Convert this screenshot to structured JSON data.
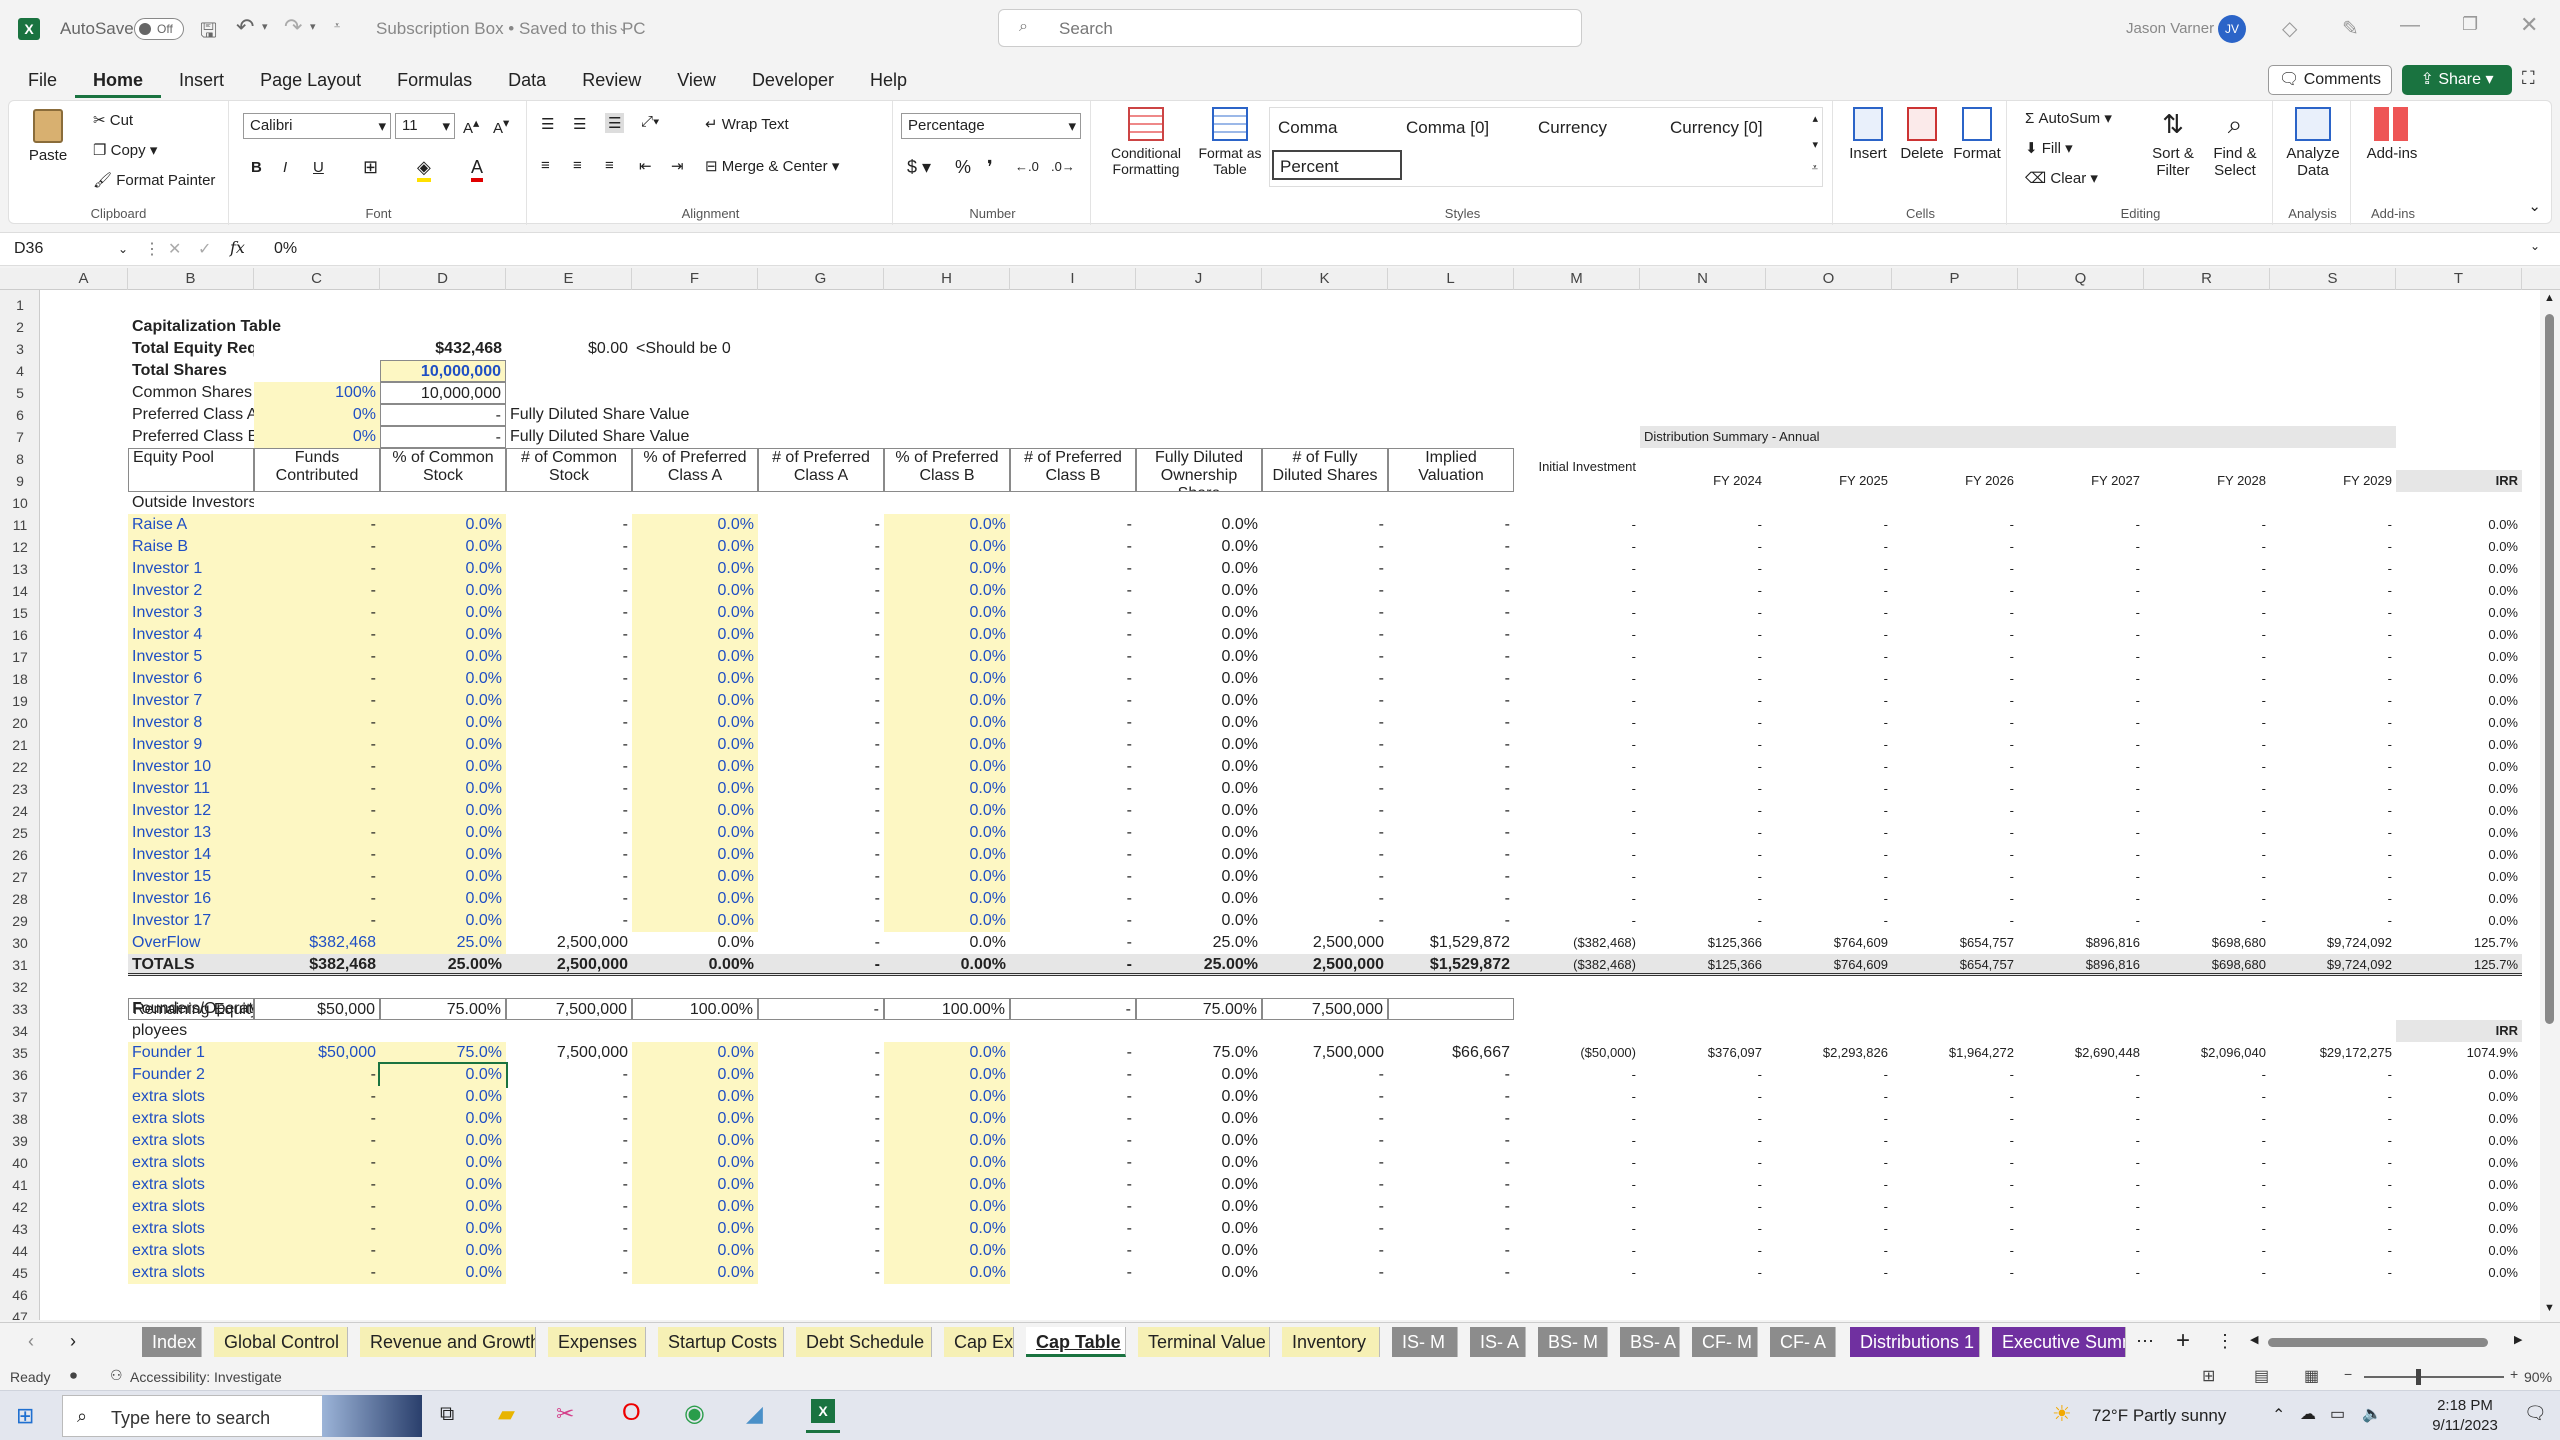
{
  "app": {
    "autosave": "AutoSave",
    "autosave_state": "Off",
    "doc_title": "Subscription Box • Saved to this PC",
    "search_placeholder": "Search",
    "user_name": "Jason Varner",
    "user_initials": "JV"
  },
  "menu": [
    "File",
    "Home",
    "Insert",
    "Page Layout",
    "Formulas",
    "Data",
    "Review",
    "View",
    "Developer",
    "Help"
  ],
  "menu_right": {
    "comments": "Comments",
    "share": "Share"
  },
  "ribbon": {
    "clipboard": {
      "paste": "Paste",
      "cut": "Cut",
      "copy": "Copy",
      "format_painter": "Format Painter",
      "label": "Clipboard"
    },
    "font": {
      "name": "Calibri",
      "size": "11",
      "label": "Font"
    },
    "alignment": {
      "wrap": "Wrap Text",
      "merge": "Merge & Center",
      "label": "Alignment"
    },
    "number": {
      "format": "Percentage",
      "label": "Number"
    },
    "styles": {
      "cond": "Conditional Formatting",
      "fmt_table": "Format as Table",
      "comma": "Comma",
      "comma0": "Comma [0]",
      "currency": "Currency",
      "currency0": "Currency [0]",
      "percent": "Percent",
      "label": "Styles"
    },
    "cells": {
      "insert": "Insert",
      "delete": "Delete",
      "format": "Format",
      "label": "Cells"
    },
    "editing": {
      "autosum": "AutoSum",
      "fill": "Fill",
      "clear": "Clear",
      "sort": "Sort & Filter",
      "find": "Find & Select",
      "label": "Editing"
    },
    "analysis": {
      "analyze": "Analyze Data",
      "label": "Analysis"
    },
    "addins": {
      "addins": "Add-ins",
      "label": "Add-ins"
    }
  },
  "formula": {
    "cell_ref": "D36",
    "fx": "fx",
    "value": "0%"
  },
  "columns": [
    "A",
    "B",
    "C",
    "D",
    "E",
    "F",
    "G",
    "H",
    "I",
    "J",
    "K",
    "L",
    "M",
    "N",
    "O",
    "P",
    "Q",
    "R",
    "S",
    "T"
  ],
  "top": {
    "title": "Capitalization Table",
    "r3": {
      "label": "Total Equity Required",
      "value": "$432,468",
      "check": "$0.00",
      "note": "<Should be 0"
    },
    "r4": {
      "label": "Total Shares",
      "value": "10,000,000"
    },
    "r5": {
      "label": "Common Shares",
      "pct": "100%",
      "value": "10,000,000"
    },
    "r6": {
      "label": "Preferred Class A",
      "pct": "0%",
      "value": "-",
      "note": "Fully Diluted Share Value"
    },
    "r7": {
      "label": "Preferred Class B",
      "pct": "0%",
      "value": "-",
      "note": "Fully Diluted Share Value"
    },
    "dist_title": "Distribution Summary - Annual"
  },
  "headers": {
    "b": "Equity Pool",
    "c": "Funds Contributed",
    "d": "% of Common Stock",
    "e": "# of Common Stock",
    "f": "% of Preferred Class A",
    "g": "# of Preferred Class A",
    "h": "% of Preferred Class B",
    "i": "# of Preferred Class B",
    "j": "Fully Diluted Ownership Share",
    "k": "# of Fully Diluted Shares",
    "l": "Implied Valuation",
    "m": "Initial Investment",
    "n": "FY 2024",
    "o": "FY 2025",
    "p": "FY 2026",
    "q": "FY 2027",
    "r": "FY 2028",
    "s": "FY 2029",
    "t": "IRR"
  },
  "outside_label": "Outside Investors",
  "investors": [
    "Raise A",
    "Raise B",
    "Investor 1",
    "Investor 2",
    "Investor 3",
    "Investor 4",
    "Investor 5",
    "Investor 6",
    "Investor 7",
    "Investor 8",
    "Investor 9",
    "Investor 10",
    "Investor 11",
    "Investor 12",
    "Investor 13",
    "Investor 14",
    "Investor 15",
    "Investor 16",
    "Investor 17"
  ],
  "blank": {
    "dash": "-",
    "pct": "0.0%"
  },
  "overflow": {
    "b": "OverFlow",
    "c": "$382,468",
    "d": "25.0%",
    "e": "2,500,000",
    "f": "0.0%",
    "g": "-",
    "h": "0.0%",
    "i": "-",
    "j": "25.0%",
    "k": "2,500,000",
    "l": "$1,529,872",
    "m": "($382,468)",
    "n": "$125,366",
    "o": "$764,609",
    "p": "$654,757",
    "q": "$896,816",
    "r": "$698,680",
    "s": "$9,724,092",
    "t": "125.7%"
  },
  "totals": {
    "b": "TOTALS",
    "c": "$382,468",
    "d": "25.00%",
    "e": "2,500,000",
    "f": "0.00%",
    "g": "-",
    "h": "0.00%",
    "i": "-",
    "j": "25.00%",
    "k": "2,500,000",
    "l": "$1,529,872",
    "m": "($382,468)",
    "n": "$125,366",
    "o": "$764,609",
    "p": "$654,757",
    "q": "$896,816",
    "r": "$698,680",
    "s": "$9,724,092",
    "t": "125.7%"
  },
  "remaining": {
    "b": "Remaining Equity",
    "c": "$50,000",
    "d": "75.00%",
    "e": "7,500,000",
    "f": "100.00%",
    "g": "-",
    "h": "100.00%",
    "i": "-",
    "j": "75.00%",
    "k": "7,500,000"
  },
  "founders_label": "Founders/Operators/Em ployees",
  "founders_label1": "Founders/Operators/Em",
  "founders_label2": "ployees",
  "irr2": "IRR",
  "founder1": {
    "b": "Founder 1",
    "c": "$50,000",
    "d": "75.0%",
    "e": "7,500,000",
    "f": "0.0%",
    "g": "-",
    "h": "0.0%",
    "i": "-",
    "j": "75.0%",
    "k": "7,500,000",
    "l": "$66,667",
    "m": "($50,000)",
    "n": "$376,097",
    "o": "$2,293,826",
    "p": "$1,964,272",
    "q": "$2,690,448",
    "r": "$2,096,040",
    "s": "$29,172,275",
    "t": "1074.9%"
  },
  "founder_rows": [
    "Founder 2",
    "extra slots",
    "extra slots",
    "extra slots",
    "extra slots",
    "extra slots",
    "extra slots",
    "extra slots",
    "extra slots",
    "extra slots"
  ],
  "tabs": [
    "Index",
    "Global Control",
    "Revenue and Growth",
    "Expenses",
    "Startup Costs",
    "Debt Schedule",
    "Cap Ex",
    "Cap Table",
    "Terminal Value",
    "Inventory",
    "IS- M",
    "IS- A",
    "BS- M",
    "BS- A",
    "CF- M",
    "CF- A",
    "Distributions 1",
    "Executive Summ"
  ],
  "status": {
    "ready": "Ready",
    "accessibility": "Accessibility: Investigate",
    "zoom": "90%"
  },
  "taskbar": {
    "search_placeholder": "Type here to search",
    "weather": "72°F  Partly sunny",
    "time": "2:18 PM",
    "date": "9/11/2023"
  },
  "colors": {
    "excel_green": "#1a7340",
    "yellow_input": "#fdf7c3",
    "blue_text": "#1f4fc4",
    "purple_tab": "#7030a0"
  }
}
